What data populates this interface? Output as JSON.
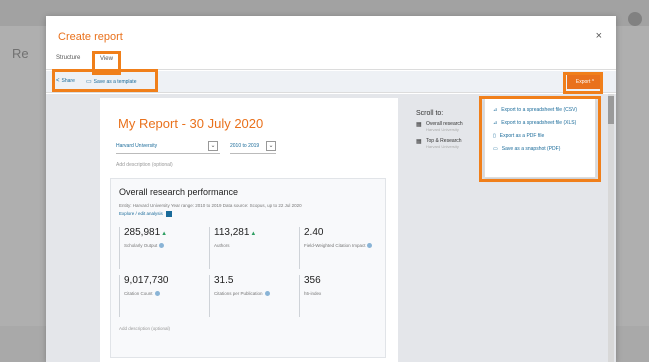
{
  "modal": {
    "title": "Create report",
    "close": "×",
    "tabs": [
      "Structure",
      "View"
    ]
  },
  "toolbar": {
    "share_label": "Share",
    "save_template_label": "Save as a template",
    "export_label": "Export ^"
  },
  "export_menu": [
    {
      "icon": "spreadsheet-icon",
      "label": "Export to a spreadsheet file (CSV)"
    },
    {
      "icon": "spreadsheet-icon",
      "label": "Export to a spreadsheet file (XLS)"
    },
    {
      "icon": "pdf-icon",
      "label": "Export as a PDF file"
    },
    {
      "icon": "snapshot-icon",
      "label": "Save as a snapshot (PDF)"
    }
  ],
  "report": {
    "title": "My Report - 30 July 2020",
    "institution": "Harvard University",
    "year_range": "2010 to 2019",
    "add_description": "Add description (optional)"
  },
  "card": {
    "title": "Overall research performance",
    "subtitle": "Entity: Harvard University   Year range: 2010 to 2019   Data source: Scopus, up to 22 Jul 2020",
    "explore_link": "Explore / edit analysis",
    "metrics": [
      {
        "value": "285,981",
        "label": "Scholarly Output",
        "arrow": true,
        "help": true
      },
      {
        "value": "113,281",
        "label": "Authors",
        "arrow": true,
        "help": false
      },
      {
        "value": "2.40",
        "label": "Field-Weighted Citation Impact",
        "arrow": false,
        "help": true
      },
      {
        "value": "9,017,730",
        "label": "Citation Count",
        "arrow": false,
        "help": true
      },
      {
        "value": "31.5",
        "label": "Citations per Publication",
        "arrow": false,
        "help": true
      },
      {
        "value": "356",
        "label": "h5-index",
        "arrow": false,
        "help": false
      }
    ],
    "add_description": "Add description (optional)"
  },
  "scroll_panel": {
    "title": "Scroll to:",
    "items": [
      {
        "label": "Overall research",
        "sub": "Harvard University"
      },
      {
        "label": "Top & Research",
        "sub": "Harvard University"
      }
    ]
  },
  "background": {
    "title": "Re"
  },
  "colors": {
    "accent": "#e9711c",
    "highlight": "#f07f1a",
    "link": "#1a6b9a"
  }
}
